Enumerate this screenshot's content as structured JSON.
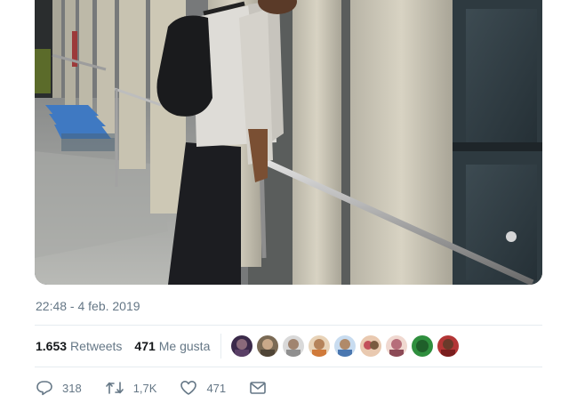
{
  "tweet": {
    "timestamp": "22:48 - 4 feb. 2019",
    "stats": {
      "retweets_count": "1.653",
      "retweets_label": "Retweets",
      "likes_count": "471",
      "likes_label": "Me gusta"
    },
    "liked_by_avatars": [
      {
        "name": "avatar-1",
        "color": "#3b2a4a"
      },
      {
        "name": "avatar-2",
        "color": "#7a6a55"
      },
      {
        "name": "avatar-3",
        "color": "#8f8f8f"
      },
      {
        "name": "avatar-4",
        "color": "#b5835a"
      },
      {
        "name": "avatar-5",
        "color": "#4a77b0"
      },
      {
        "name": "avatar-6",
        "color": "#c2505a"
      },
      {
        "name": "avatar-7",
        "color": "#b66e7a"
      },
      {
        "name": "avatar-8",
        "color": "#2f8f3e"
      },
      {
        "name": "avatar-9",
        "color": "#b33636"
      }
    ],
    "actions": {
      "replies": "318",
      "retweets": "1,7K",
      "likes": "471"
    }
  },
  "colors": {
    "secondary_text": "#657786",
    "divider": "#e6ecf0"
  },
  "icons": [
    "reply-icon",
    "retweet-icon",
    "like-icon",
    "message-icon"
  ]
}
